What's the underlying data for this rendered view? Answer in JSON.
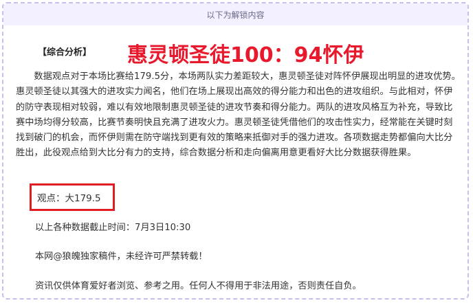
{
  "banner": {
    "text": "以下为解锁内容"
  },
  "section_tag": "【综合分析】",
  "headline": "惠灵顿圣徒100：94怀伊",
  "analysis_paragraph": "数据观点对于本场比赛给179.5分，本场两队实力差距较大，惠灵顿圣徒对阵怀伊展现出明显的进攻优势。惠灵顿圣徒以其强大的进攻实力闻名，他们在场上展现出高效的得分能力和出色的进攻组织。与此相对，怀伊的防守表现相对较弱，难以有效地限制惠灵顿圣徒的进攻节奏和得分能力。两队的进攻风格互为补充，导致比赛中场均得分较高，比赛节奏明快且充满了进攻火力。惠灵顿圣徒凭借他们的攻击性实力，经常能在关键时刻找到破门的机会，而怀伊则需在防守端找到更有效的策略来抵御对手的强力进攻。各项数据走势都偏向大比分胜出，此役观点给到大比分有力的支持，综合数据分析和走向偏离用意更看好大比分数据获得胜果。",
  "verdict": "观点：大179.5",
  "data_cutoff": "以上各种数据截止时间：7月3日10:30",
  "copyright": "本网@狼魄独家稿件，未经许可严禁转载！",
  "disclaimer": "资讯仅供体育爱好者浏览、参考之用。任何人不得用于非法用途，否则责任自负。",
  "colors": {
    "headline": "#e8192c",
    "verdict_border": "#e01b22",
    "banner_bg": "#f3f0ff",
    "panel_border": "#c7bdf0"
  }
}
